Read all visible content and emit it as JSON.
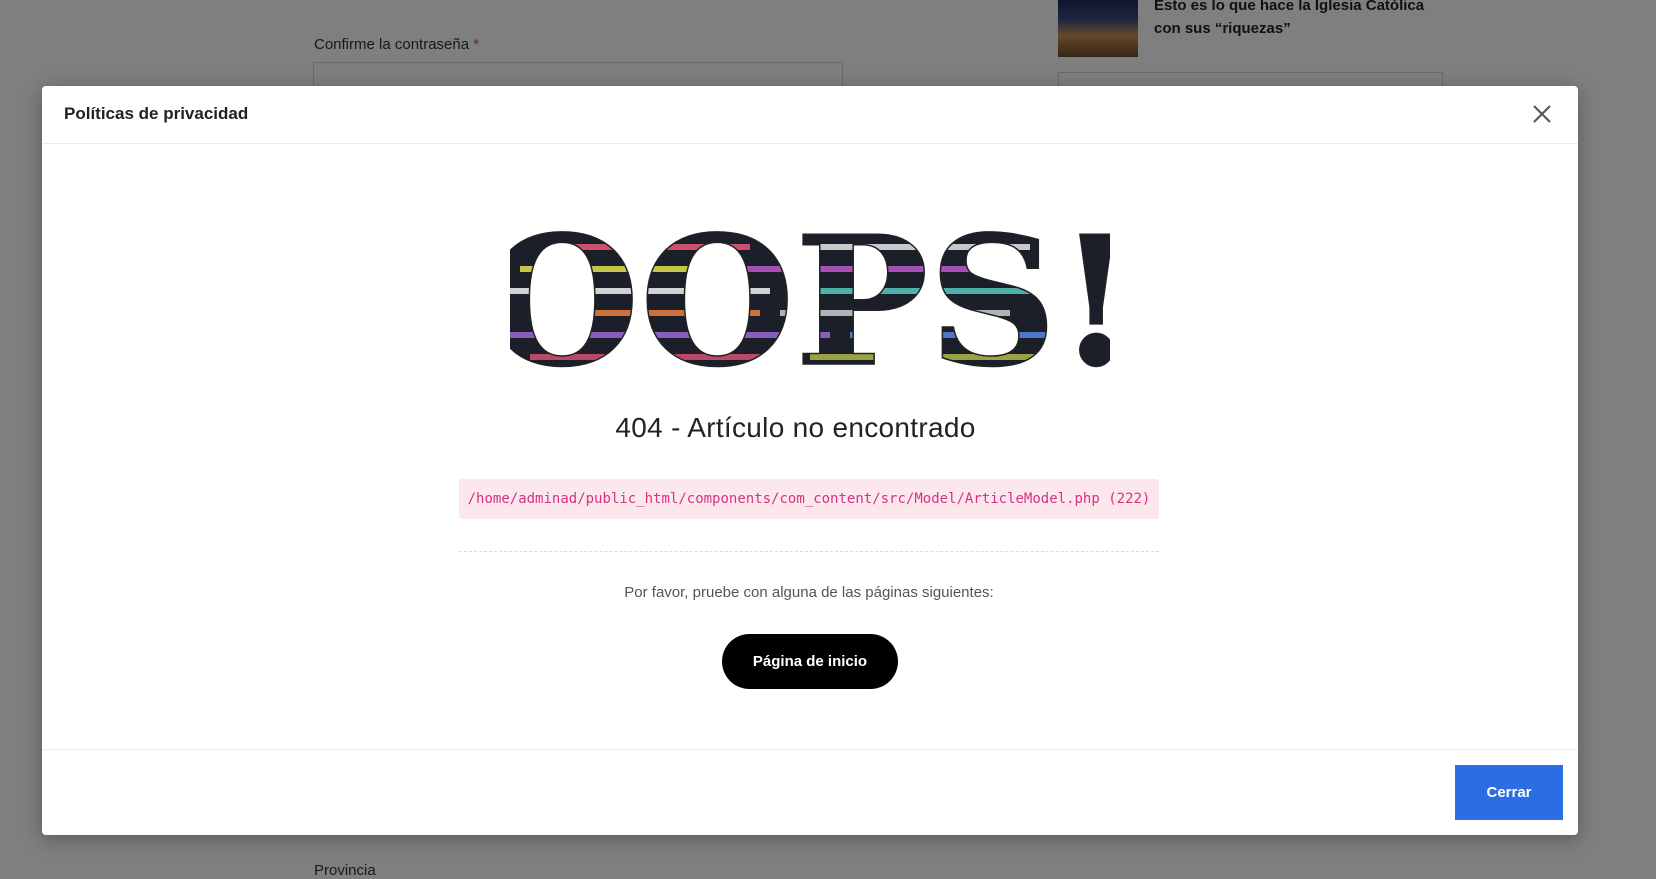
{
  "background": {
    "confirm_password_label": "Confirme la contraseña",
    "required_mark": "*",
    "article_title": "Esto es lo que hace la Iglesia Católica con sus “riquezas”",
    "province_label": "Provincia"
  },
  "modal": {
    "title": "Políticas de privacidad",
    "close_icon": "close-icon",
    "oops_text": "OOPS!",
    "error_title": "404 - Artículo no encontrado",
    "error_path": "/home/adminad/public_html/components/com_content/src/Model/ArticleModel.php (222)",
    "suggest_text": "Por favor, pruebe con alguna de las páginas siguientes:",
    "home_button_label": "Página de inicio",
    "close_button_label": "Cerrar"
  },
  "colors": {
    "overlay": "#808080",
    "accent_button": "#2b6de5",
    "home_button": "#000000",
    "error_path_bg": "#fce8ec",
    "error_path_text": "#d63384"
  }
}
